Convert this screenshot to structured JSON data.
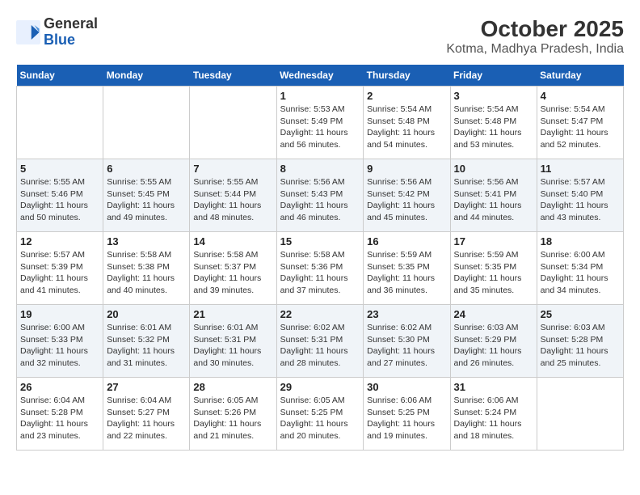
{
  "header": {
    "logo_line1": "General",
    "logo_line2": "Blue",
    "title": "October 2025",
    "subtitle": "Kotma, Madhya Pradesh, India"
  },
  "calendar": {
    "days_of_week": [
      "Sunday",
      "Monday",
      "Tuesday",
      "Wednesday",
      "Thursday",
      "Friday",
      "Saturday"
    ],
    "weeks": [
      [
        {
          "day": "",
          "info": ""
        },
        {
          "day": "",
          "info": ""
        },
        {
          "day": "",
          "info": ""
        },
        {
          "day": "1",
          "info": "Sunrise: 5:53 AM\nSunset: 5:49 PM\nDaylight: 11 hours and 56 minutes."
        },
        {
          "day": "2",
          "info": "Sunrise: 5:54 AM\nSunset: 5:48 PM\nDaylight: 11 hours and 54 minutes."
        },
        {
          "day": "3",
          "info": "Sunrise: 5:54 AM\nSunset: 5:48 PM\nDaylight: 11 hours and 53 minutes."
        },
        {
          "day": "4",
          "info": "Sunrise: 5:54 AM\nSunset: 5:47 PM\nDaylight: 11 hours and 52 minutes."
        }
      ],
      [
        {
          "day": "5",
          "info": "Sunrise: 5:55 AM\nSunset: 5:46 PM\nDaylight: 11 hours and 50 minutes."
        },
        {
          "day": "6",
          "info": "Sunrise: 5:55 AM\nSunset: 5:45 PM\nDaylight: 11 hours and 49 minutes."
        },
        {
          "day": "7",
          "info": "Sunrise: 5:55 AM\nSunset: 5:44 PM\nDaylight: 11 hours and 48 minutes."
        },
        {
          "day": "8",
          "info": "Sunrise: 5:56 AM\nSunset: 5:43 PM\nDaylight: 11 hours and 46 minutes."
        },
        {
          "day": "9",
          "info": "Sunrise: 5:56 AM\nSunset: 5:42 PM\nDaylight: 11 hours and 45 minutes."
        },
        {
          "day": "10",
          "info": "Sunrise: 5:56 AM\nSunset: 5:41 PM\nDaylight: 11 hours and 44 minutes."
        },
        {
          "day": "11",
          "info": "Sunrise: 5:57 AM\nSunset: 5:40 PM\nDaylight: 11 hours and 43 minutes."
        }
      ],
      [
        {
          "day": "12",
          "info": "Sunrise: 5:57 AM\nSunset: 5:39 PM\nDaylight: 11 hours and 41 minutes."
        },
        {
          "day": "13",
          "info": "Sunrise: 5:58 AM\nSunset: 5:38 PM\nDaylight: 11 hours and 40 minutes."
        },
        {
          "day": "14",
          "info": "Sunrise: 5:58 AM\nSunset: 5:37 PM\nDaylight: 11 hours and 39 minutes."
        },
        {
          "day": "15",
          "info": "Sunrise: 5:58 AM\nSunset: 5:36 PM\nDaylight: 11 hours and 37 minutes."
        },
        {
          "day": "16",
          "info": "Sunrise: 5:59 AM\nSunset: 5:35 PM\nDaylight: 11 hours and 36 minutes."
        },
        {
          "day": "17",
          "info": "Sunrise: 5:59 AM\nSunset: 5:35 PM\nDaylight: 11 hours and 35 minutes."
        },
        {
          "day": "18",
          "info": "Sunrise: 6:00 AM\nSunset: 5:34 PM\nDaylight: 11 hours and 34 minutes."
        }
      ],
      [
        {
          "day": "19",
          "info": "Sunrise: 6:00 AM\nSunset: 5:33 PM\nDaylight: 11 hours and 32 minutes."
        },
        {
          "day": "20",
          "info": "Sunrise: 6:01 AM\nSunset: 5:32 PM\nDaylight: 11 hours and 31 minutes."
        },
        {
          "day": "21",
          "info": "Sunrise: 6:01 AM\nSunset: 5:31 PM\nDaylight: 11 hours and 30 minutes."
        },
        {
          "day": "22",
          "info": "Sunrise: 6:02 AM\nSunset: 5:31 PM\nDaylight: 11 hours and 28 minutes."
        },
        {
          "day": "23",
          "info": "Sunrise: 6:02 AM\nSunset: 5:30 PM\nDaylight: 11 hours and 27 minutes."
        },
        {
          "day": "24",
          "info": "Sunrise: 6:03 AM\nSunset: 5:29 PM\nDaylight: 11 hours and 26 minutes."
        },
        {
          "day": "25",
          "info": "Sunrise: 6:03 AM\nSunset: 5:28 PM\nDaylight: 11 hours and 25 minutes."
        }
      ],
      [
        {
          "day": "26",
          "info": "Sunrise: 6:04 AM\nSunset: 5:28 PM\nDaylight: 11 hours and 23 minutes."
        },
        {
          "day": "27",
          "info": "Sunrise: 6:04 AM\nSunset: 5:27 PM\nDaylight: 11 hours and 22 minutes."
        },
        {
          "day": "28",
          "info": "Sunrise: 6:05 AM\nSunset: 5:26 PM\nDaylight: 11 hours and 21 minutes."
        },
        {
          "day": "29",
          "info": "Sunrise: 6:05 AM\nSunset: 5:25 PM\nDaylight: 11 hours and 20 minutes."
        },
        {
          "day": "30",
          "info": "Sunrise: 6:06 AM\nSunset: 5:25 PM\nDaylight: 11 hours and 19 minutes."
        },
        {
          "day": "31",
          "info": "Sunrise: 6:06 AM\nSunset: 5:24 PM\nDaylight: 11 hours and 18 minutes."
        },
        {
          "day": "",
          "info": ""
        }
      ]
    ]
  }
}
